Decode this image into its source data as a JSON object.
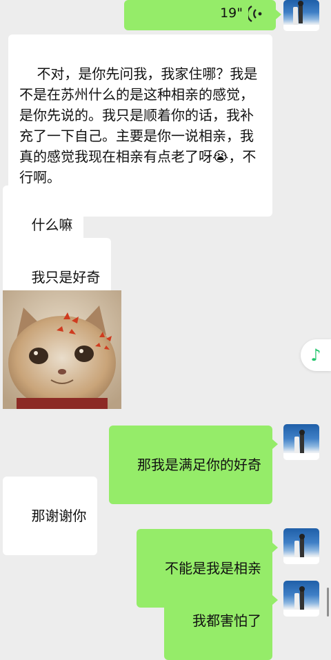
{
  "messages": [
    {
      "id": "voice",
      "direction": "out",
      "type": "voice",
      "duration": "19\""
    },
    {
      "id": "m1",
      "direction": "in",
      "type": "text",
      "text": "不对，是你先问我，我家住哪？我是不是在苏州什么的是这种相亲的感觉，是你先说的。我只是顺着你的话，我补充了一下自己。主要是你一说相亲，我真的感觉我现在相亲有点老了呀😭，不行啊。"
    },
    {
      "id": "m2",
      "direction": "in",
      "type": "text",
      "text": "什么嘛"
    },
    {
      "id": "m3",
      "direction": "in",
      "type": "text",
      "text": "我只是好奇"
    },
    {
      "id": "m4",
      "direction": "in",
      "type": "sticker",
      "icon": "angry-cat-sticker"
    },
    {
      "id": "m5",
      "direction": "out",
      "type": "text",
      "text": "那我是满足你的好奇"
    },
    {
      "id": "m6",
      "direction": "in",
      "type": "text",
      "text": "那谢谢你"
    },
    {
      "id": "m7",
      "direction": "out",
      "type": "text",
      "text": "不能是我是相亲"
    },
    {
      "id": "m8",
      "direction": "out",
      "type": "text",
      "text": "我都害怕了"
    }
  ],
  "floating": {
    "icon": "music-note-icon",
    "glyph": "♪"
  },
  "colors": {
    "background": "#ededed",
    "incoming": "#ffffff",
    "outgoing": "#95ec69",
    "accent": "#21c46b"
  }
}
